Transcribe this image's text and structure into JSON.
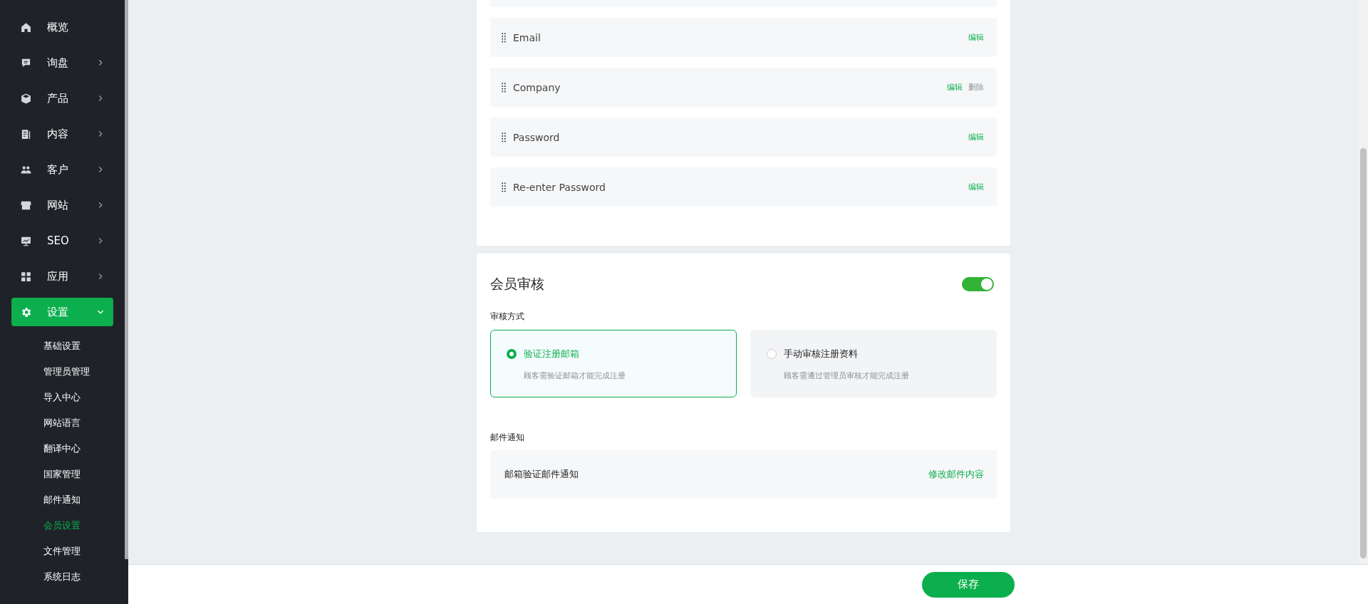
{
  "sidebar": {
    "items": [
      {
        "label": "概览",
        "has_arrow": false,
        "expanded": false,
        "selected": false
      },
      {
        "label": "询盘",
        "has_arrow": true,
        "expanded": false,
        "selected": false
      },
      {
        "label": "产品",
        "has_arrow": true,
        "expanded": false,
        "selected": false
      },
      {
        "label": "内容",
        "has_arrow": true,
        "expanded": false,
        "selected": false
      },
      {
        "label": "客户",
        "has_arrow": true,
        "expanded": false,
        "selected": false
      },
      {
        "label": "网站",
        "has_arrow": true,
        "expanded": false,
        "selected": false
      },
      {
        "label": "SEO",
        "has_arrow": true,
        "expanded": false,
        "selected": false
      },
      {
        "label": "应用",
        "has_arrow": true,
        "expanded": false,
        "selected": false
      },
      {
        "label": "设置",
        "has_arrow": true,
        "expanded": true,
        "selected": true,
        "children": [
          {
            "label": "基础设置",
            "selected": false
          },
          {
            "label": "管理员管理",
            "selected": false
          },
          {
            "label": "导入中心",
            "selected": false
          },
          {
            "label": "网站语言",
            "selected": false
          },
          {
            "label": "翻译中心",
            "selected": false
          },
          {
            "label": "国家管理",
            "selected": false
          },
          {
            "label": "邮件通知",
            "selected": false
          },
          {
            "label": "会员设置",
            "selected": true
          },
          {
            "label": "文件管理",
            "selected": false
          },
          {
            "label": "系统日志",
            "selected": false
          }
        ]
      }
    ]
  },
  "fields": [
    {
      "label": "Email",
      "actions": [
        {
          "label": "编辑",
          "kind": "edit"
        }
      ]
    },
    {
      "label": "Company",
      "actions": [
        {
          "label": "编辑",
          "kind": "edit"
        },
        {
          "label": "删除",
          "kind": "delete"
        }
      ]
    },
    {
      "label": "Password",
      "actions": [
        {
          "label": "编辑",
          "kind": "edit"
        }
      ]
    },
    {
      "label": "Re-enter Password",
      "actions": [
        {
          "label": "编辑",
          "kind": "edit"
        }
      ]
    }
  ],
  "review": {
    "title": "会员审核",
    "on": true,
    "method_label": "审核方式",
    "options": [
      {
        "title": "验证注册邮箱",
        "description": "顾客需验证邮箱才能完成注册",
        "selected": true
      },
      {
        "title": "手动审核注册资料",
        "description": "顾客需通过管理员审核才能完成注册",
        "selected": false
      }
    ],
    "notify_label": "邮件通知",
    "notify_item": "邮箱验证邮件通知",
    "notify_action": "修改邮件内容"
  },
  "save_button": "保存"
}
